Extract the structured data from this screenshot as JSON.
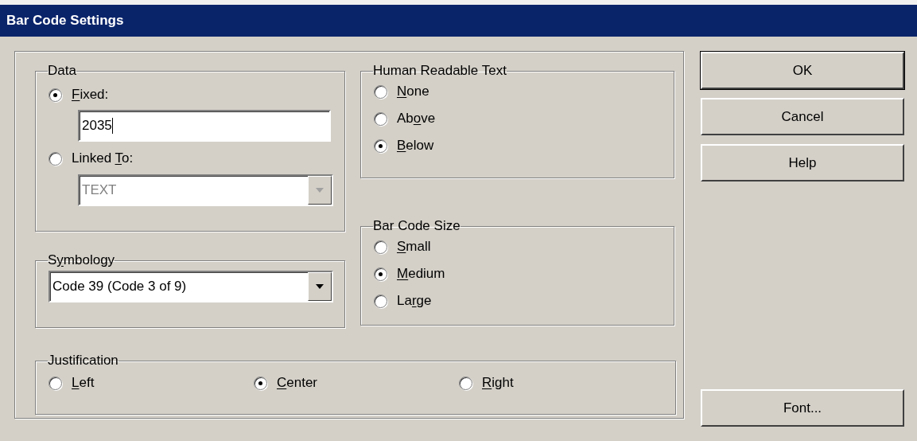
{
  "window": {
    "title": "Bar Code Settings"
  },
  "data_group": {
    "title": "Data",
    "options": [
      {
        "label": {
          "key": "F",
          "after": "ixed:"
        },
        "selected": true
      },
      {
        "label": {
          "before": "Linked ",
          "key": "T",
          "after": "o:"
        },
        "selected": false
      }
    ],
    "fixed_value": "2035",
    "linked_field": {
      "value": "TEXT",
      "disabled": true
    }
  },
  "symbology": {
    "title": {
      "before": "S",
      "key": "y",
      "after": "mbology"
    },
    "value": "Code 39 (Code 3 of 9)"
  },
  "human_readable_text": {
    "title": "Human Readable Text",
    "options": [
      {
        "label": {
          "key": "N",
          "after": "one"
        },
        "selected": false
      },
      {
        "label": {
          "before": "Ab",
          "key": "o",
          "after": "ve"
        },
        "selected": false
      },
      {
        "label": {
          "key": "B",
          "after": "elow"
        },
        "selected": true
      }
    ]
  },
  "bar_code_size": {
    "title": "Bar Code Size",
    "options": [
      {
        "label": {
          "key": "S",
          "after": "mall"
        },
        "selected": false
      },
      {
        "label": {
          "key": "M",
          "after": "edium"
        },
        "selected": true
      },
      {
        "label": {
          "before": "La",
          "key": "r",
          "after": "ge"
        },
        "selected": false
      }
    ]
  },
  "justification": {
    "title": "Justification",
    "options": [
      {
        "label": {
          "key": "L",
          "after": "eft"
        },
        "selected": false
      },
      {
        "label": {
          "key": "C",
          "after": "enter"
        },
        "selected": true
      },
      {
        "label": {
          "key": "R",
          "after": "ight"
        },
        "selected": false
      }
    ]
  },
  "buttons": [
    {
      "label": "OK",
      "default": true
    },
    {
      "label": "Cancel",
      "default": false
    },
    {
      "label": "Help",
      "default": false
    },
    {
      "label": "Font...",
      "default": false
    }
  ]
}
